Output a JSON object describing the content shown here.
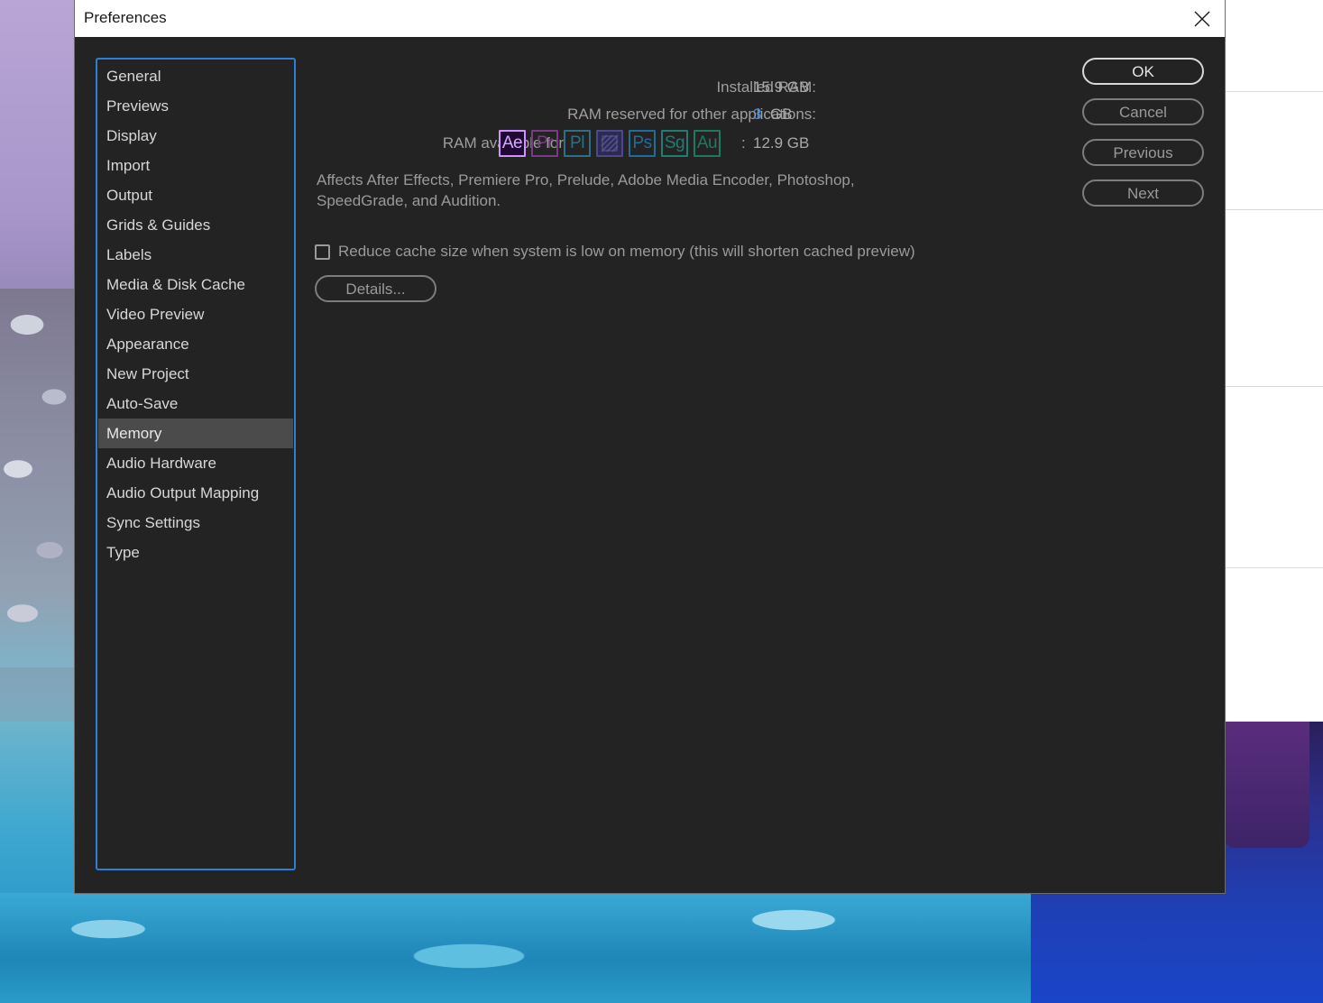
{
  "dialog": {
    "title": "Preferences"
  },
  "categories": [
    {
      "label": "General"
    },
    {
      "label": "Previews"
    },
    {
      "label": "Display"
    },
    {
      "label": "Import"
    },
    {
      "label": "Output"
    },
    {
      "label": "Grids & Guides"
    },
    {
      "label": "Labels"
    },
    {
      "label": "Media & Disk Cache"
    },
    {
      "label": "Video Preview"
    },
    {
      "label": "Appearance"
    },
    {
      "label": "New Project"
    },
    {
      "label": "Auto-Save"
    },
    {
      "label": "Memory",
      "selected": true
    },
    {
      "label": "Audio Hardware"
    },
    {
      "label": "Audio Output Mapping"
    },
    {
      "label": "Sync Settings"
    },
    {
      "label": "Type"
    }
  ],
  "memory": {
    "installed_ram_label": "Installed RAM:",
    "installed_ram_value": "15.9 GB",
    "reserved_label": "RAM reserved for other applications:",
    "reserved_value": "3",
    "reserved_unit": "GB",
    "available_label": "RAM available for",
    "available_separator": ":",
    "available_value": "12.9 GB",
    "apps": [
      {
        "name": "after-effects",
        "abbr": "Ae",
        "color": "#d291ff",
        "active": true
      },
      {
        "name": "premiere-pro",
        "abbr": "Pr",
        "color": "#7a3a86",
        "active": false
      },
      {
        "name": "prelude",
        "abbr": "Pl",
        "color": "#2e6f86",
        "active": false
      },
      {
        "name": "media-encoder",
        "abbr": "",
        "color": "#4b4a86",
        "active": false
      },
      {
        "name": "photoshop",
        "abbr": "Ps",
        "color": "#1f6e97",
        "active": false
      },
      {
        "name": "speedgrade",
        "abbr": "Sg",
        "color": "#1f7d72",
        "active": false
      },
      {
        "name": "audition",
        "abbr": "Au",
        "color": "#1d7a5e",
        "active": false
      }
    ],
    "affects_text": "Affects After Effects, Premiere Pro, Prelude, Adobe Media Encoder, Photoshop, SpeedGrade, and Audition.",
    "reduce_cache_label": "Reduce cache size when system is low on memory (this will shorten cached preview)",
    "reduce_cache_checked": false,
    "details_label": "Details..."
  },
  "buttons": {
    "ok": "OK",
    "cancel": "Cancel",
    "previous": "Previous",
    "next": "Next"
  },
  "colors": {
    "dialog_bg": "#232323",
    "selection_bg": "#4b4b4b",
    "focus_border": "#2d7fd4",
    "accent_value": "#3d8ee0"
  }
}
